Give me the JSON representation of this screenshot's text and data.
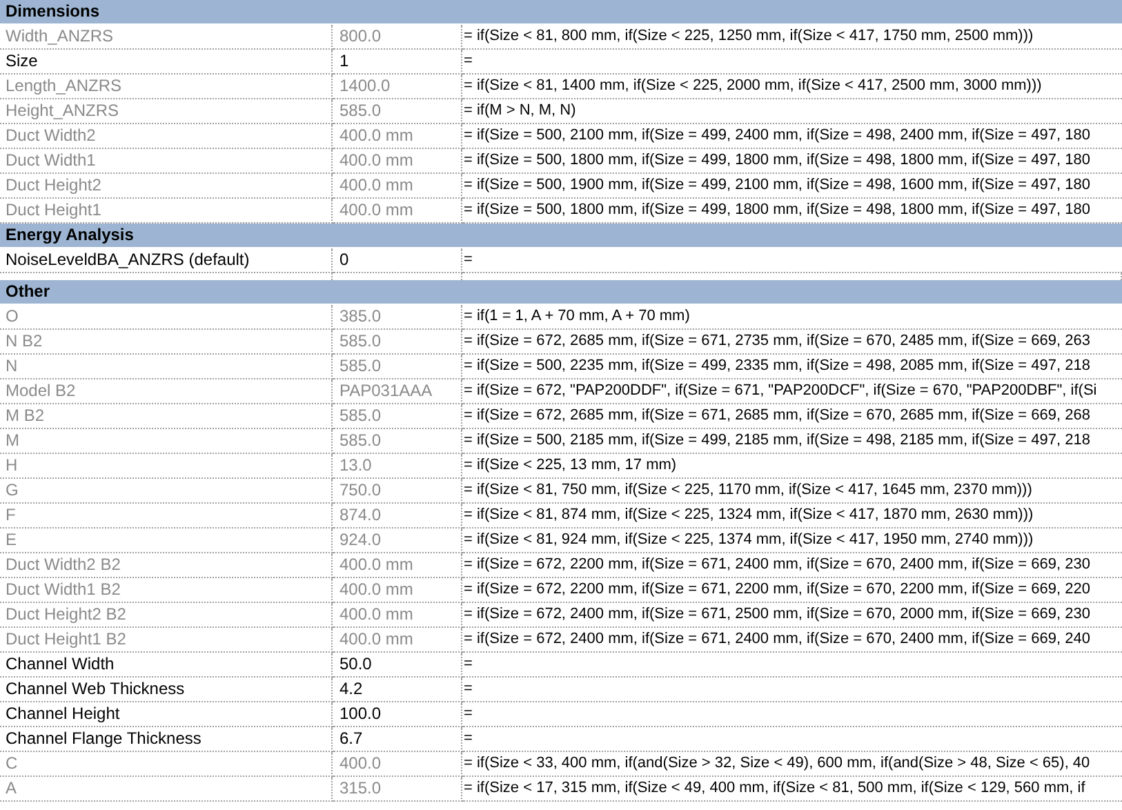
{
  "sections": [
    {
      "title": "Dimensions",
      "rows": [
        {
          "name": "Width_ANZRS",
          "value": "800.0",
          "formula": "= if(Size < 81, 800 mm, if(Size < 225, 1250 mm, if(Size < 417, 1750 mm, 2500 mm)))",
          "disabled": true
        },
        {
          "name": "Size",
          "value": "1",
          "formula": "=",
          "disabled": false
        },
        {
          "name": "Length_ANZRS",
          "value": "1400.0",
          "formula": "= if(Size < 81, 1400 mm, if(Size < 225, 2000 mm, if(Size < 417, 2500 mm, 3000 mm)))",
          "disabled": true
        },
        {
          "name": "Height_ANZRS",
          "value": "585.0",
          "formula": "= if(M > N, M, N)",
          "disabled": true
        },
        {
          "name": "Duct Width2",
          "value": "400.0 mm",
          "formula": "= if(Size = 500, 2100 mm, if(Size = 499, 2400 mm, if(Size = 498, 2400 mm, if(Size = 497, 180",
          "disabled": true
        },
        {
          "name": "Duct Width1",
          "value": "400.0 mm",
          "formula": "= if(Size = 500, 1800 mm, if(Size = 499, 1800 mm, if(Size = 498, 1800 mm, if(Size = 497, 180",
          "disabled": true
        },
        {
          "name": "Duct Height2",
          "value": "400.0 mm",
          "formula": "= if(Size = 500, 1900 mm, if(Size = 499, 2100 mm, if(Size = 498, 1600 mm, if(Size = 497, 180",
          "disabled": true
        },
        {
          "name": "Duct Height1",
          "value": "400.0 mm",
          "formula": "= if(Size = 500, 1800 mm, if(Size = 499, 1800 mm, if(Size = 498, 1800 mm, if(Size = 497, 180",
          "disabled": true
        }
      ]
    },
    {
      "title": "Energy Analysis",
      "rows": [
        {
          "name": "NoiseLeveldBA_ANZRS (default)",
          "value": "0",
          "formula": "=",
          "disabled": false
        }
      ]
    },
    {
      "title": "Other",
      "rows": [
        {
          "name": "O",
          "value": "385.0",
          "formula": "= if(1 = 1, A + 70 mm, A + 70 mm)",
          "disabled": true
        },
        {
          "name": "N B2",
          "value": "585.0",
          "formula": "= if(Size = 672, 2685 mm, if(Size = 671, 2735 mm, if(Size = 670, 2485 mm, if(Size = 669, 263",
          "disabled": true
        },
        {
          "name": "N",
          "value": "585.0",
          "formula": "= if(Size = 500, 2235 mm, if(Size = 499, 2335 mm, if(Size = 498, 2085 mm, if(Size = 497, 218",
          "disabled": true
        },
        {
          "name": "Model B2",
          "value": "PAP031AAA",
          "formula": "= if(Size = 672, \"PAP200DDF\", if(Size = 671, \"PAP200DCF\", if(Size = 670, \"PAP200DBF\", if(Si",
          "disabled": true
        },
        {
          "name": "M B2",
          "value": "585.0",
          "formula": "= if(Size = 672, 2685 mm, if(Size = 671, 2685 mm, if(Size = 670, 2685 mm, if(Size = 669, 268",
          "disabled": true
        },
        {
          "name": "M",
          "value": "585.0",
          "formula": "= if(Size = 500, 2185 mm, if(Size = 499, 2185 mm, if(Size = 498, 2185 mm, if(Size = 497, 218",
          "disabled": true
        },
        {
          "name": "H",
          "value": "13.0",
          "formula": "= if(Size < 225, 13 mm, 17 mm)",
          "disabled": true
        },
        {
          "name": "G",
          "value": "750.0",
          "formula": "= if(Size < 81, 750 mm, if(Size < 225, 1170 mm, if(Size < 417, 1645 mm, 2370 mm)))",
          "disabled": true
        },
        {
          "name": "F",
          "value": "874.0",
          "formula": "= if(Size < 81, 874 mm, if(Size < 225, 1324 mm, if(Size < 417, 1870 mm, 2630 mm)))",
          "disabled": true
        },
        {
          "name": "E",
          "value": "924.0",
          "formula": "= if(Size < 81, 924 mm, if(Size < 225, 1374 mm, if(Size < 417, 1950 mm, 2740 mm)))",
          "disabled": true
        },
        {
          "name": "Duct Width2 B2",
          "value": "400.0 mm",
          "formula": "= if(Size = 672, 2200 mm, if(Size = 671, 2400 mm, if(Size = 670, 2400 mm, if(Size = 669, 230",
          "disabled": true
        },
        {
          "name": "Duct Width1 B2",
          "value": "400.0 mm",
          "formula": "= if(Size = 672, 2200 mm, if(Size = 671, 2200 mm, if(Size = 670, 2200 mm, if(Size = 669, 220",
          "disabled": true
        },
        {
          "name": "Duct Height2 B2",
          "value": "400.0 mm",
          "formula": "= if(Size = 672, 2400 mm, if(Size = 671, 2500 mm, if(Size = 670, 2000 mm, if(Size = 669, 230",
          "disabled": true
        },
        {
          "name": "Duct Height1 B2",
          "value": "400.0 mm",
          "formula": "= if(Size = 672, 2400 mm, if(Size = 671, 2400 mm, if(Size = 670, 2400 mm, if(Size = 669, 240",
          "disabled": true
        },
        {
          "name": "Channel Width",
          "value": "50.0",
          "formula": "=",
          "disabled": false
        },
        {
          "name": "Channel Web Thickness",
          "value": "4.2",
          "formula": "=",
          "disabled": false
        },
        {
          "name": "Channel Height",
          "value": "100.0",
          "formula": "=",
          "disabled": false
        },
        {
          "name": "Channel Flange Thickness",
          "value": "6.7",
          "formula": "=",
          "disabled": false
        },
        {
          "name": "C",
          "value": "400.0",
          "formula": "= if(Size < 33, 400 mm, if(and(Size > 32, Size < 49), 600 mm, if(and(Size > 48, Size < 65), 40",
          "disabled": true
        },
        {
          "name": "A",
          "value": "315.0",
          "formula": "= if(Size < 17, 315 mm, if(Size < 49, 400 mm, if(Size < 81, 500 mm, if(Size < 129, 560 mm, if",
          "disabled": true
        }
      ]
    }
  ]
}
